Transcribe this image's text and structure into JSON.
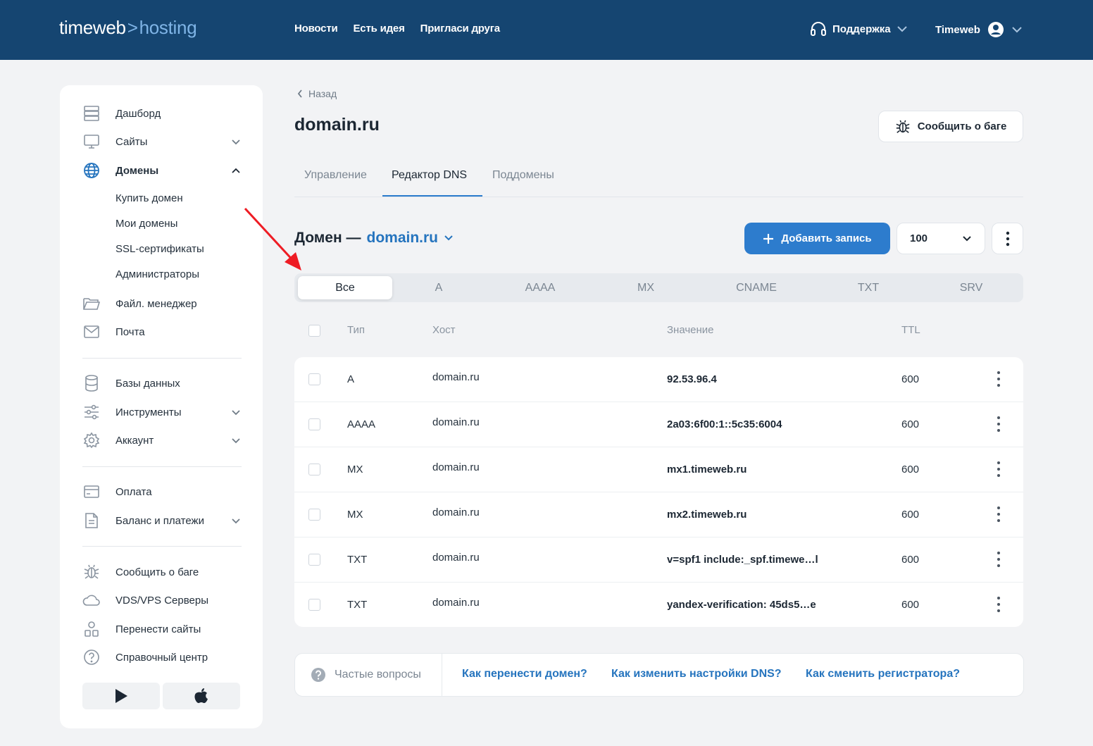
{
  "header": {
    "logo_main": "timeweb",
    "logo_sep": ">",
    "logo_sub": "hosting",
    "nav": [
      "Новости",
      "Есть идея",
      "Пригласи друга"
    ],
    "support_label": "Поддержка",
    "account_label": "Timeweb"
  },
  "sidebar": {
    "items": [
      {
        "label": "Дашборд",
        "icon": "server-icon"
      },
      {
        "label": "Сайты",
        "icon": "monitor-icon"
      },
      {
        "label": "Домены",
        "icon": "globe-icon"
      },
      {
        "label": "Файл. менеджер",
        "icon": "folder-icon"
      },
      {
        "label": "Почта",
        "icon": "mail-icon"
      },
      {
        "label": "Базы данных",
        "icon": "database-icon"
      },
      {
        "label": "Инструменты",
        "icon": "sliders-icon"
      },
      {
        "label": "Аккаунт",
        "icon": "gear-icon"
      },
      {
        "label": "Оплата",
        "icon": "card-icon"
      },
      {
        "label": "Баланс и платежи",
        "icon": "document-icon"
      },
      {
        "label": "Сообщить о баге",
        "icon": "bug-icon"
      },
      {
        "label": "VDS/VPS Серверы",
        "icon": "cloud-icon"
      },
      {
        "label": "Перенести сайты",
        "icon": "transfer-icon"
      },
      {
        "label": "Справочный центр",
        "icon": "help-icon"
      }
    ],
    "domain_subitems": [
      "Купить домен",
      "Мои домены",
      "SSL-сертификаты",
      "Администраторы"
    ]
  },
  "main": {
    "back_label": "Назад",
    "page_title": "domain.ru",
    "bug_button": "Сообщить о баге",
    "tabs": [
      "Управление",
      "Редактор DNS",
      "Поддомены"
    ],
    "domain_prefix": "Домен —",
    "domain_name": "domain.ru",
    "add_record": "Добавить запись",
    "per_page": "100",
    "filters": [
      "Все",
      "A",
      "AAAA",
      "MX",
      "CNAME",
      "TXT",
      "SRV"
    ],
    "columns": [
      "Тип",
      "Хост",
      "Значение",
      "TTL"
    ],
    "records": [
      {
        "type": "A",
        "host": "domain.ru",
        "value": "92.53.96.4",
        "ttl": "600"
      },
      {
        "type": "AAAA",
        "host": "domain.ru",
        "value": "2a03:6f00:1::5c35:6004",
        "ttl": "600"
      },
      {
        "type": "MX",
        "host": "domain.ru",
        "value": "mx1.timeweb.ru",
        "ttl": "600"
      },
      {
        "type": "MX",
        "host": "domain.ru",
        "value": "mx2.timeweb.ru",
        "ttl": "600"
      },
      {
        "type": "TXT",
        "host": "domain.ru",
        "value": "v=spf1 include:_spf.timewe…l",
        "ttl": "600"
      },
      {
        "type": "TXT",
        "host": "domain.ru",
        "value": "yandex-verification: 45ds5…e",
        "ttl": "600"
      }
    ],
    "faq_label": "Частые вопросы",
    "faq_links": [
      "Как перенести домен?",
      "Как изменить настройки DNS?",
      "Как сменить регистратора?"
    ]
  },
  "colors": {
    "header_bg": "#154571",
    "accent": "#2d7ccd",
    "annotation_arrow": "#ee1c24"
  }
}
